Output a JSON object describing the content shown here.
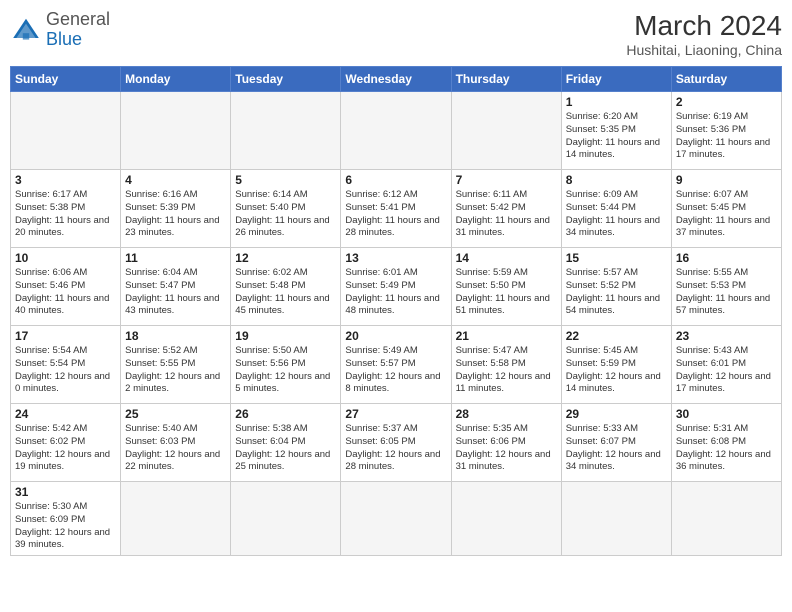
{
  "header": {
    "logo_general": "General",
    "logo_blue": "Blue",
    "title": "March 2024",
    "subtitle": "Hushitai, Liaoning, China"
  },
  "weekdays": [
    "Sunday",
    "Monday",
    "Tuesday",
    "Wednesday",
    "Thursday",
    "Friday",
    "Saturday"
  ],
  "weeks": [
    [
      {
        "day": "",
        "info": ""
      },
      {
        "day": "",
        "info": ""
      },
      {
        "day": "",
        "info": ""
      },
      {
        "day": "",
        "info": ""
      },
      {
        "day": "",
        "info": ""
      },
      {
        "day": "1",
        "info": "Sunrise: 6:20 AM\nSunset: 5:35 PM\nDaylight: 11 hours and 14 minutes."
      },
      {
        "day": "2",
        "info": "Sunrise: 6:19 AM\nSunset: 5:36 PM\nDaylight: 11 hours and 17 minutes."
      }
    ],
    [
      {
        "day": "3",
        "info": "Sunrise: 6:17 AM\nSunset: 5:38 PM\nDaylight: 11 hours and 20 minutes."
      },
      {
        "day": "4",
        "info": "Sunrise: 6:16 AM\nSunset: 5:39 PM\nDaylight: 11 hours and 23 minutes."
      },
      {
        "day": "5",
        "info": "Sunrise: 6:14 AM\nSunset: 5:40 PM\nDaylight: 11 hours and 26 minutes."
      },
      {
        "day": "6",
        "info": "Sunrise: 6:12 AM\nSunset: 5:41 PM\nDaylight: 11 hours and 28 minutes."
      },
      {
        "day": "7",
        "info": "Sunrise: 6:11 AM\nSunset: 5:42 PM\nDaylight: 11 hours and 31 minutes."
      },
      {
        "day": "8",
        "info": "Sunrise: 6:09 AM\nSunset: 5:44 PM\nDaylight: 11 hours and 34 minutes."
      },
      {
        "day": "9",
        "info": "Sunrise: 6:07 AM\nSunset: 5:45 PM\nDaylight: 11 hours and 37 minutes."
      }
    ],
    [
      {
        "day": "10",
        "info": "Sunrise: 6:06 AM\nSunset: 5:46 PM\nDaylight: 11 hours and 40 minutes."
      },
      {
        "day": "11",
        "info": "Sunrise: 6:04 AM\nSunset: 5:47 PM\nDaylight: 11 hours and 43 minutes."
      },
      {
        "day": "12",
        "info": "Sunrise: 6:02 AM\nSunset: 5:48 PM\nDaylight: 11 hours and 45 minutes."
      },
      {
        "day": "13",
        "info": "Sunrise: 6:01 AM\nSunset: 5:49 PM\nDaylight: 11 hours and 48 minutes."
      },
      {
        "day": "14",
        "info": "Sunrise: 5:59 AM\nSunset: 5:50 PM\nDaylight: 11 hours and 51 minutes."
      },
      {
        "day": "15",
        "info": "Sunrise: 5:57 AM\nSunset: 5:52 PM\nDaylight: 11 hours and 54 minutes."
      },
      {
        "day": "16",
        "info": "Sunrise: 5:55 AM\nSunset: 5:53 PM\nDaylight: 11 hours and 57 minutes."
      }
    ],
    [
      {
        "day": "17",
        "info": "Sunrise: 5:54 AM\nSunset: 5:54 PM\nDaylight: 12 hours and 0 minutes."
      },
      {
        "day": "18",
        "info": "Sunrise: 5:52 AM\nSunset: 5:55 PM\nDaylight: 12 hours and 2 minutes."
      },
      {
        "day": "19",
        "info": "Sunrise: 5:50 AM\nSunset: 5:56 PM\nDaylight: 12 hours and 5 minutes."
      },
      {
        "day": "20",
        "info": "Sunrise: 5:49 AM\nSunset: 5:57 PM\nDaylight: 12 hours and 8 minutes."
      },
      {
        "day": "21",
        "info": "Sunrise: 5:47 AM\nSunset: 5:58 PM\nDaylight: 12 hours and 11 minutes."
      },
      {
        "day": "22",
        "info": "Sunrise: 5:45 AM\nSunset: 5:59 PM\nDaylight: 12 hours and 14 minutes."
      },
      {
        "day": "23",
        "info": "Sunrise: 5:43 AM\nSunset: 6:01 PM\nDaylight: 12 hours and 17 minutes."
      }
    ],
    [
      {
        "day": "24",
        "info": "Sunrise: 5:42 AM\nSunset: 6:02 PM\nDaylight: 12 hours and 19 minutes."
      },
      {
        "day": "25",
        "info": "Sunrise: 5:40 AM\nSunset: 6:03 PM\nDaylight: 12 hours and 22 minutes."
      },
      {
        "day": "26",
        "info": "Sunrise: 5:38 AM\nSunset: 6:04 PM\nDaylight: 12 hours and 25 minutes."
      },
      {
        "day": "27",
        "info": "Sunrise: 5:37 AM\nSunset: 6:05 PM\nDaylight: 12 hours and 28 minutes."
      },
      {
        "day": "28",
        "info": "Sunrise: 5:35 AM\nSunset: 6:06 PM\nDaylight: 12 hours and 31 minutes."
      },
      {
        "day": "29",
        "info": "Sunrise: 5:33 AM\nSunset: 6:07 PM\nDaylight: 12 hours and 34 minutes."
      },
      {
        "day": "30",
        "info": "Sunrise: 5:31 AM\nSunset: 6:08 PM\nDaylight: 12 hours and 36 minutes."
      }
    ],
    [
      {
        "day": "31",
        "info": "Sunrise: 5:30 AM\nSunset: 6:09 PM\nDaylight: 12 hours and 39 minutes."
      },
      {
        "day": "",
        "info": ""
      },
      {
        "day": "",
        "info": ""
      },
      {
        "day": "",
        "info": ""
      },
      {
        "day": "",
        "info": ""
      },
      {
        "day": "",
        "info": ""
      },
      {
        "day": "",
        "info": ""
      }
    ]
  ]
}
